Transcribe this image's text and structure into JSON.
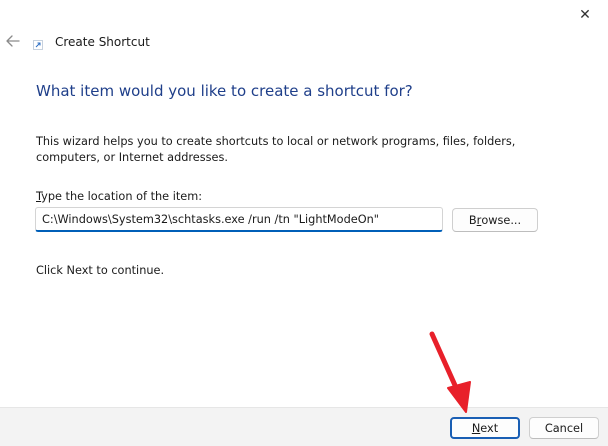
{
  "window": {
    "title": "Create Shortcut",
    "close_glyph": "✕"
  },
  "icons": {
    "back": "back-arrow-icon",
    "app": "shortcut-icon",
    "close": "close-icon"
  },
  "wizard": {
    "heading": "What item would you like to create a shortcut for?",
    "description": "This wizard helps you to create shortcuts to local or network programs, files, folders, computers, or Internet addresses.",
    "location_label_access_key": "T",
    "location_label_rest": "ype the location of the item:",
    "location_value": "C:\\Windows\\System32\\schtasks.exe /run /tn \"LightModeOn\"",
    "browse_access_key": "r",
    "browse_label_pre": "B",
    "browse_label_post": "owse...",
    "continue_text": "Click Next to continue."
  },
  "footer": {
    "next_access_key": "N",
    "next_label_rest": "ext",
    "cancel_label": "Cancel"
  },
  "colors": {
    "heading": "#1f3f8a",
    "accent": "#005fb8",
    "annotation_arrow": "#e8202a"
  }
}
